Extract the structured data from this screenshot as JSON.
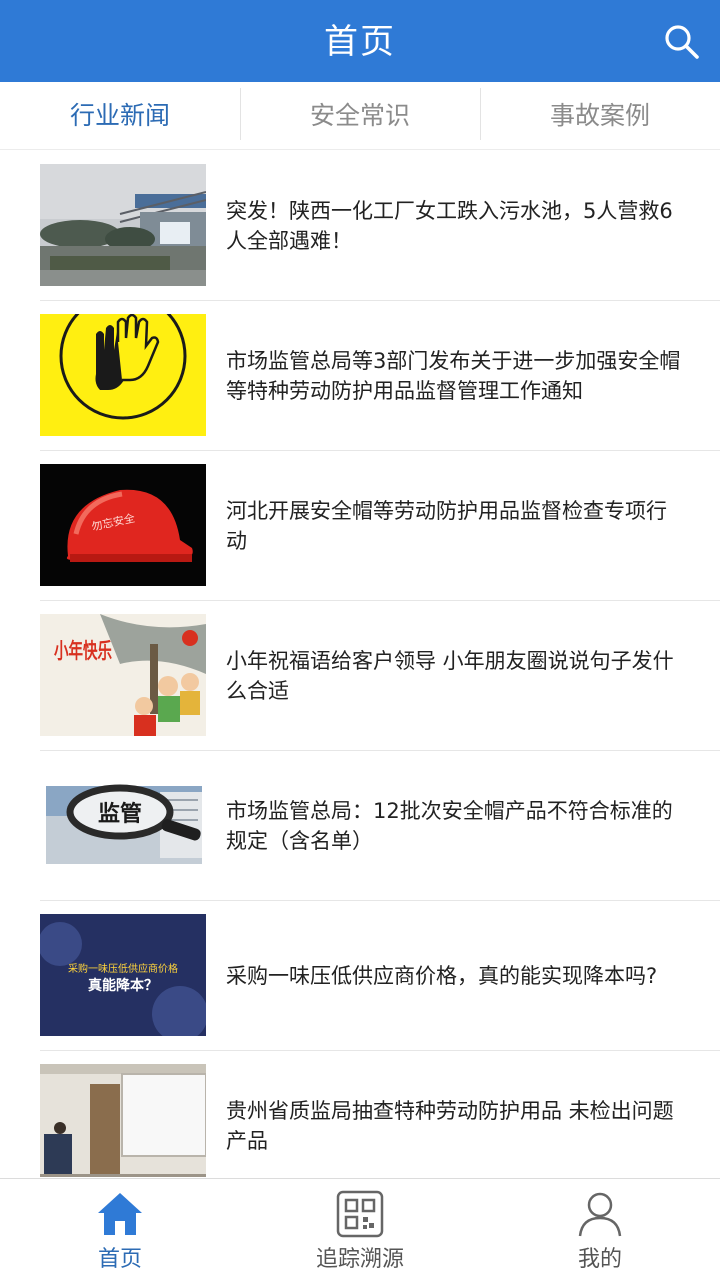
{
  "header": {
    "title": "首页",
    "search_icon": "search-icon"
  },
  "tabs": [
    {
      "label": "行业新闻",
      "active": true
    },
    {
      "label": "安全常识",
      "active": false
    },
    {
      "label": "事故案例",
      "active": false
    }
  ],
  "news": [
    {
      "title": "突发！陕西一化工厂女工跌入污水池，5人营救6人全部遇难！",
      "thumb": "factory-photo"
    },
    {
      "title": "市场监管总局等3部门发布关于进一步加强安全帽等特种劳动防护用品监督管理工作通知",
      "thumb": "gloves-icon"
    },
    {
      "title": "河北开展安全帽等劳动防护用品监督检查专项行动",
      "thumb": "helmet-photo",
      "thumb_text": "勿忘安全"
    },
    {
      "title": "小年祝福语给客户领导 小年朋友圈说说句子发什么合适",
      "thumb": "new-year-illustration",
      "thumb_text": "小年快乐"
    },
    {
      "title": "市场监管总局：12批次安全帽产品不符合标准的规定（含名单）",
      "thumb": "magnifier-photo",
      "thumb_text": "监管"
    },
    {
      "title": "采购一味压低供应商价格，真的能实现降本吗?",
      "thumb": "banner-image",
      "thumb_text_1": "采购一味压低供应商价格",
      "thumb_text_2": "真能降本？"
    },
    {
      "title": "贵州省质监局抽查特种劳动防护用品  未检出问题产品",
      "thumb": "meeting-photo"
    }
  ],
  "tabbar": [
    {
      "label": "首页",
      "icon": "home-icon",
      "active": true
    },
    {
      "label": "追踪溯源",
      "icon": "qr-code-icon",
      "active": false
    },
    {
      "label": "我的",
      "icon": "user-icon",
      "active": false
    }
  ],
  "colors": {
    "primary": "#2f7ad6",
    "active_text": "#2c6bb4",
    "inactive_text": "#8b8b8b"
  }
}
